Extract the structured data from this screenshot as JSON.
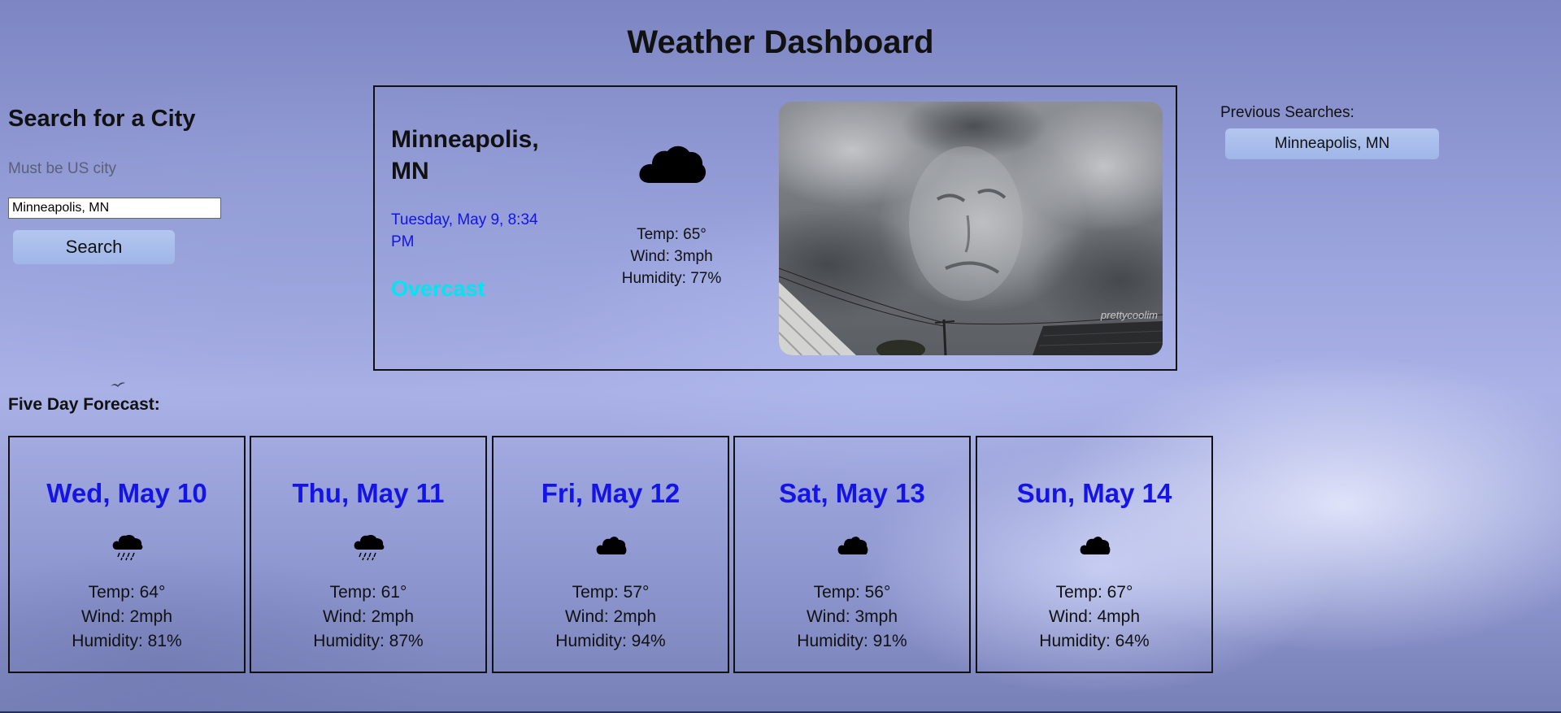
{
  "page": {
    "title": "Weather Dashboard"
  },
  "search": {
    "heading": "Search for a City",
    "hint": "Must be US city",
    "input_value": "Minneapolis, MN",
    "button_label": "Search"
  },
  "current": {
    "city": "Minneapolis, MN",
    "date": "Tuesday, May 9, 8:34 PM",
    "condition": "Overcast",
    "condition_color": "#00e5ef",
    "icon": "cloud-icon",
    "temp": "Temp: 65°",
    "wind": "Wind: 3mph",
    "humidity": "Humidity: 77%",
    "image_watermark": "prettycoolim"
  },
  "previous": {
    "label": "Previous Searches:",
    "items": [
      "Minneapolis, MN"
    ]
  },
  "forecast": {
    "heading": "Five Day Forecast:",
    "days": [
      {
        "date": "Wed, May 10",
        "icon": "rain-cloud-icon",
        "temp": "Temp: 64°",
        "wind": "Wind: 2mph",
        "humidity": "Humidity: 81%"
      },
      {
        "date": "Thu, May 11",
        "icon": "rain-cloud-icon",
        "temp": "Temp: 61°",
        "wind": "Wind: 2mph",
        "humidity": "Humidity: 87%"
      },
      {
        "date": "Fri, May 12",
        "icon": "cloud-icon",
        "temp": "Temp: 57°",
        "wind": "Wind: 2mph",
        "humidity": "Humidity: 94%"
      },
      {
        "date": "Sat, May 13",
        "icon": "cloud-icon",
        "temp": "Temp: 56°",
        "wind": "Wind: 3mph",
        "humidity": "Humidity: 91%"
      },
      {
        "date": "Sun, May 14",
        "icon": "cloud-icon",
        "temp": "Temp: 67°",
        "wind": "Wind: 4mph",
        "humidity": "Humidity: 64%"
      }
    ]
  },
  "colors": {
    "date_blue": "#1414e6",
    "button_blue": "#a9bdeb"
  }
}
